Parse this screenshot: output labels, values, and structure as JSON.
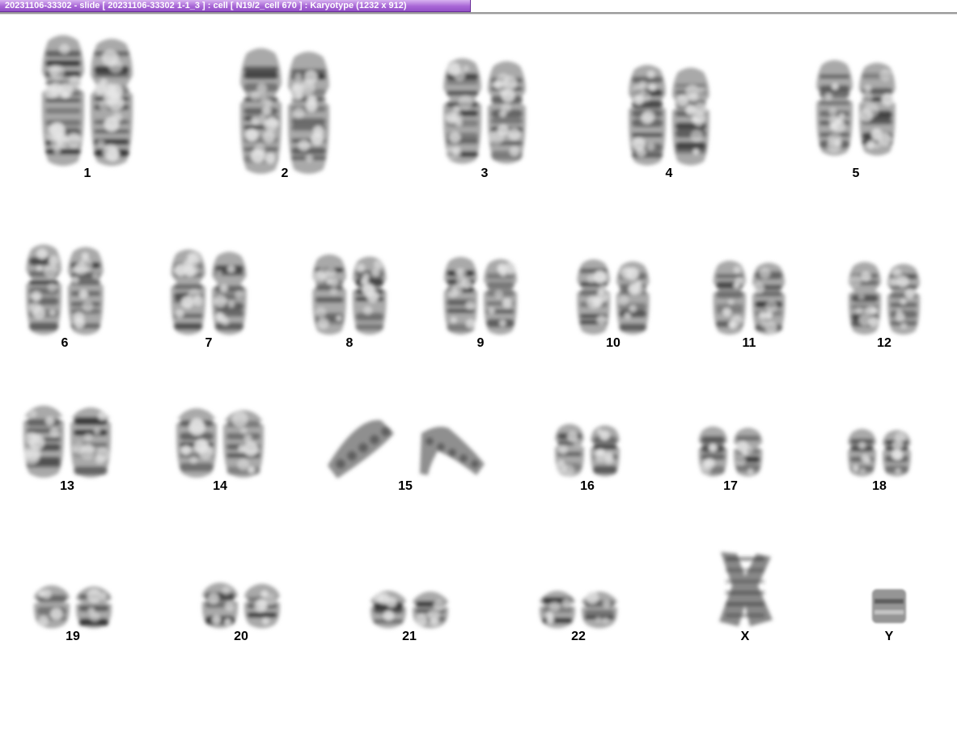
{
  "window": {
    "title": "20231106-33302 - slide [ 20231106-33302 1-1_3 ] : cell [ N19/2_cell 670 ] : Karyotype  (1232 x 912)"
  },
  "karyotype": {
    "chromosomes": [
      {
        "label": "1",
        "size": 1.0,
        "shape": "long"
      },
      {
        "label": "2",
        "size": 0.96,
        "shape": "long"
      },
      {
        "label": "3",
        "size": 0.8,
        "shape": "long"
      },
      {
        "label": "4",
        "size": 0.76,
        "shape": "long"
      },
      {
        "label": "5",
        "size": 0.72,
        "shape": "long"
      },
      {
        "label": "6",
        "size": 0.68,
        "shape": "long"
      },
      {
        "label": "7",
        "size": 0.64,
        "shape": "long"
      },
      {
        "label": "8",
        "size": 0.6,
        "shape": "long"
      },
      {
        "label": "9",
        "size": 0.58,
        "shape": "long"
      },
      {
        "label": "10",
        "size": 0.56,
        "shape": "long"
      },
      {
        "label": "11",
        "size": 0.55,
        "shape": "long"
      },
      {
        "label": "12",
        "size": 0.54,
        "shape": "long"
      },
      {
        "label": "13",
        "size": 0.46,
        "shape": "acro"
      },
      {
        "label": "14",
        "size": 0.44,
        "shape": "acro"
      },
      {
        "label": "15",
        "size": 0.42,
        "shape": "bent"
      },
      {
        "label": "16",
        "size": 0.38,
        "shape": "long"
      },
      {
        "label": "17",
        "size": 0.36,
        "shape": "long"
      },
      {
        "label": "18",
        "size": 0.34,
        "shape": "long"
      },
      {
        "label": "19",
        "size": 0.26,
        "shape": "small"
      },
      {
        "label": "20",
        "size": 0.28,
        "shape": "small"
      },
      {
        "label": "21",
        "size": 0.22,
        "shape": "small"
      },
      {
        "label": "22",
        "size": 0.22,
        "shape": "small"
      },
      {
        "label": "X",
        "size": 0.6,
        "shape": "x"
      },
      {
        "label": "Y",
        "size": 0.24,
        "shape": "y"
      }
    ],
    "colors": {
      "band_dark": "#2a2a2a",
      "band_light": "#9a9a9a",
      "label": "#000000"
    }
  }
}
